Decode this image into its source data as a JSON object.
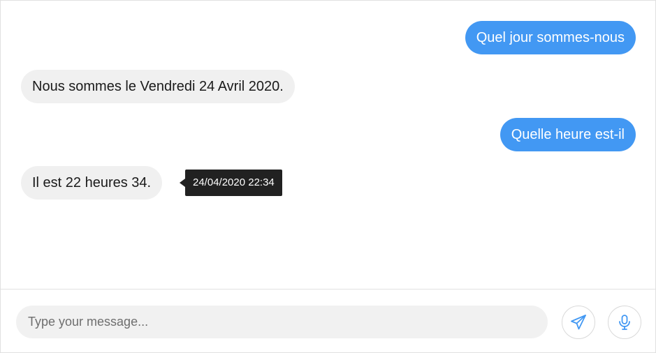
{
  "conversation": {
    "messages": [
      {
        "sender": "user",
        "text": "Quel jour sommes-nous"
      },
      {
        "sender": "bot",
        "text": "Nous sommes le Vendredi 24 Avril 2020."
      },
      {
        "sender": "user",
        "text": "Quelle heure est-il"
      },
      {
        "sender": "bot",
        "text": "Il est 22 heures 34."
      }
    ],
    "tooltip": {
      "text": "24/04/2020 22:34"
    }
  },
  "composer": {
    "placeholder": "Type your message...",
    "value": "",
    "send_icon": "paper-plane-icon",
    "mic_icon": "microphone-icon"
  },
  "colors": {
    "user_bubble": "#4298f3",
    "bot_bubble": "#f0f0f0",
    "tooltip_bg": "#212121",
    "icon_accent": "#4298f3"
  }
}
